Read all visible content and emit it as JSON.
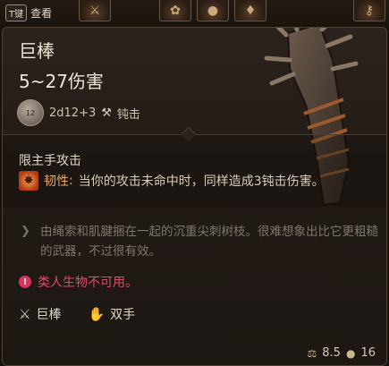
{
  "top_bar": {
    "key_label": "T键",
    "key_action": "查看",
    "slot_icons": [
      "sword-icon",
      "bag-icon",
      "orb-icon",
      "potion-icon",
      "key-icon"
    ]
  },
  "item": {
    "name": "巨棒",
    "damage_line": "5~27伤害",
    "dice_value": "12",
    "dice_formula": "2d12+3",
    "damage_type": "钝击",
    "section_title": "限主手攻击",
    "property_name": "韧性",
    "property_sep": ":",
    "property_desc": "当你的攻击未命中时，同样造成3钝击伤害。",
    "flavor_text": "由绳索和肌腱捆在一起的沉重尖刺树枝。很难想象出比它更粗糙的武器，不过很有效。",
    "warning": "类人生物不可用。",
    "tags": [
      {
        "label": "巨棒",
        "icon": "crossed-clubs-icon"
      },
      {
        "label": "双手",
        "icon": "open-hand-icon"
      }
    ],
    "weight": "8.5",
    "price": "16"
  },
  "colors": {
    "title": "#efe6d8",
    "property_accent": "#e8a86b",
    "warning": "#e04a6a",
    "flavor": "#7f776c"
  }
}
